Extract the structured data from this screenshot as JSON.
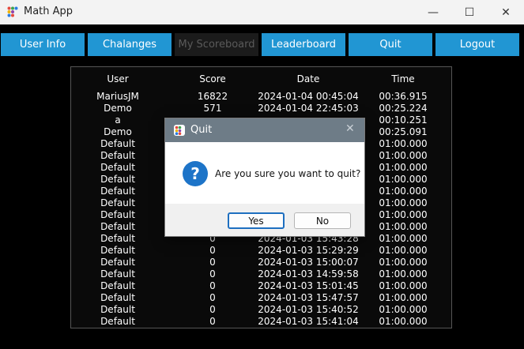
{
  "window": {
    "title": "Math App",
    "minimize": "—",
    "maximize": "☐",
    "close": "✕"
  },
  "nav": [
    {
      "label": "User Info"
    },
    {
      "label": "Chalanges"
    },
    {
      "label": "My Scoreboard"
    },
    {
      "label": "Leaderboard"
    },
    {
      "label": "Quit"
    },
    {
      "label": "Logout"
    }
  ],
  "table": {
    "headers": {
      "user": "User",
      "score": "Score",
      "date": "Date",
      "time": "Time"
    },
    "rows": [
      {
        "user": "MariusJM",
        "score": "16822",
        "date": "2024-01-04 00:45:04",
        "time": "00:36.915"
      },
      {
        "user": "Demo",
        "score": "571",
        "date": "2024-01-04 22:45:03",
        "time": "00:25.224"
      },
      {
        "user": "a",
        "score": "",
        "date": "",
        "time": "00:10.251"
      },
      {
        "user": "Demo",
        "score": "",
        "date": "",
        "time": "00:25.091"
      },
      {
        "user": "Default",
        "score": "",
        "date": "",
        "time": "01:00.000"
      },
      {
        "user": "Default",
        "score": "",
        "date": "",
        "time": "01:00.000"
      },
      {
        "user": "Default",
        "score": "",
        "date": "",
        "time": "01:00.000"
      },
      {
        "user": "Default",
        "score": "",
        "date": "",
        "time": "01:00.000"
      },
      {
        "user": "Default",
        "score": "",
        "date": "",
        "time": "01:00.000"
      },
      {
        "user": "Default",
        "score": "",
        "date": "",
        "time": "01:00.000"
      },
      {
        "user": "Default",
        "score": "",
        "date": "",
        "time": "01:00.000"
      },
      {
        "user": "Default",
        "score": "",
        "date": "",
        "time": "01:00.000"
      },
      {
        "user": "Default",
        "score": "0",
        "date": "2024-01-03 15:43:28",
        "time": "01:00.000"
      },
      {
        "user": "Default",
        "score": "0",
        "date": "2024-01-03 15:29:29",
        "time": "01:00.000"
      },
      {
        "user": "Default",
        "score": "0",
        "date": "2024-01-03 15:00:07",
        "time": "01:00.000"
      },
      {
        "user": "Default",
        "score": "0",
        "date": "2024-01-03 14:59:58",
        "time": "01:00.000"
      },
      {
        "user": "Default",
        "score": "0",
        "date": "2024-01-03 15:01:45",
        "time": "01:00.000"
      },
      {
        "user": "Default",
        "score": "0",
        "date": "2024-01-03 15:47:57",
        "time": "01:00.000"
      },
      {
        "user": "Default",
        "score": "0",
        "date": "2024-01-03 15:40:52",
        "time": "01:00.000"
      },
      {
        "user": "Default",
        "score": "0",
        "date": "2024-01-03 15:41:04",
        "time": "01:00.000"
      }
    ]
  },
  "dialog": {
    "title": "Quit",
    "close": "✕",
    "icon": "?",
    "message": "Are you sure you want to quit?",
    "yes": "Yes",
    "no": "No"
  },
  "colors": {
    "nav_accent": "#2196d3",
    "dialog_title": "#6e7c87",
    "question_icon": "#1d74c8"
  }
}
